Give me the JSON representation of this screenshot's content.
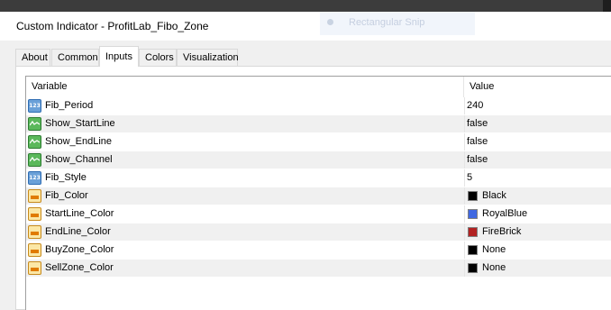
{
  "window": {
    "title": "Custom Indicator - ProfitLab_Fibo_Zone"
  },
  "overlay": {
    "label": "Rectangular Snip"
  },
  "tabs": [
    {
      "label": "About",
      "active": false
    },
    {
      "label": "Common",
      "active": false
    },
    {
      "label": "Inputs",
      "active": true
    },
    {
      "label": "Colors",
      "active": false
    },
    {
      "label": "Visualization",
      "active": false
    }
  ],
  "table": {
    "headers": {
      "variable": "Variable",
      "value": "Value"
    },
    "rows": [
      {
        "icon": "numeric-icon",
        "icon_text": "123",
        "variable": "Fib_Period",
        "value": "240"
      },
      {
        "icon": "boolean-icon",
        "variable": "Show_StartLine",
        "value": "false"
      },
      {
        "icon": "boolean-icon",
        "variable": "Show_EndLine",
        "value": "false"
      },
      {
        "icon": "boolean-icon",
        "variable": "Show_Channel",
        "value": "false"
      },
      {
        "icon": "numeric-icon",
        "icon_text": "123",
        "variable": "Fib_Style",
        "value": "5"
      },
      {
        "icon": "color-icon",
        "variable": "Fib_Color",
        "value": "Black",
        "swatch": "#000000"
      },
      {
        "icon": "color-icon",
        "variable": "StartLine_Color",
        "value": "RoyalBlue",
        "swatch": "#4169e1"
      },
      {
        "icon": "color-icon",
        "variable": "EndLine_Color",
        "value": "FireBrick",
        "swatch": "#b22222"
      },
      {
        "icon": "color-icon",
        "variable": "BuyZone_Color",
        "value": "None",
        "swatch": "#000000"
      },
      {
        "icon": "color-icon",
        "variable": "SellZone_Color",
        "value": "None",
        "swatch": "#000000"
      }
    ]
  }
}
